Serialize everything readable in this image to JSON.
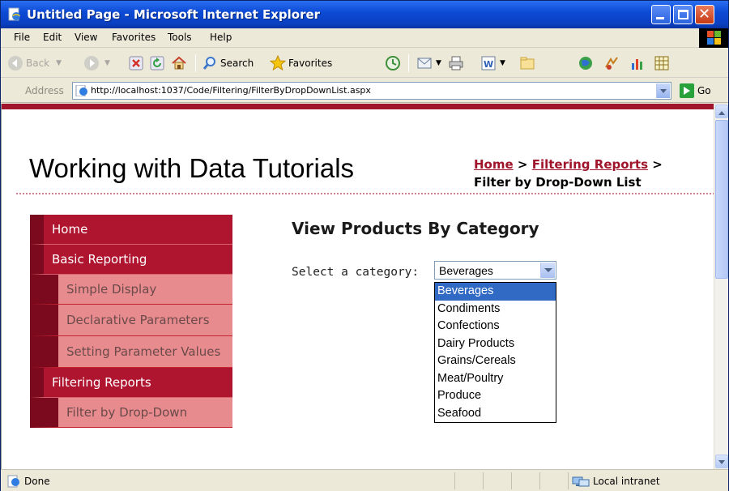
{
  "window": {
    "title": "Untitled Page - Microsoft Internet Explorer"
  },
  "menubar": {
    "items": [
      "File",
      "Edit",
      "View",
      "Favorites",
      "Tools",
      "Help"
    ]
  },
  "toolbar": {
    "back_label": "Back",
    "search_label": "Search",
    "favorites_label": "Favorites"
  },
  "address": {
    "label": "Address",
    "url": "http://localhost:1037/Code/Filtering/FilterByDropDownList.aspx",
    "go_label": "Go"
  },
  "page": {
    "site_title": "Working with Data Tutorials",
    "breadcrumb": {
      "home": "Home",
      "sep": ">",
      "filtering": "Filtering Reports",
      "current": "Filter by Drop-Down List"
    },
    "menu": [
      {
        "label": "Home",
        "level": 1
      },
      {
        "label": "Basic Reporting",
        "level": 1
      },
      {
        "label": "Simple Display",
        "level": 2
      },
      {
        "label": "Declarative Parameters",
        "level": 2
      },
      {
        "label": "Setting Parameter Values",
        "level": 2
      },
      {
        "label": "Filtering Reports",
        "level": 1
      },
      {
        "label": "Filter by Drop-Down",
        "level": 2
      }
    ],
    "heading": "View Products By Category",
    "select_label": "Select a category:",
    "select_value": "Beverages",
    "categories": [
      "Beverages",
      "Condiments",
      "Confections",
      "Dairy Products",
      "Grains/Cereals",
      "Meat/Poultry",
      "Produce",
      "Seafood"
    ],
    "highlighted_option": "Beverages"
  },
  "status": {
    "text": "Done",
    "zone": "Local intranet"
  },
  "colors": {
    "brand_red": "#a0152b",
    "menu_dark": "#b01530",
    "menu_light": "#e88b8e",
    "selection_blue": "#316ac5"
  }
}
